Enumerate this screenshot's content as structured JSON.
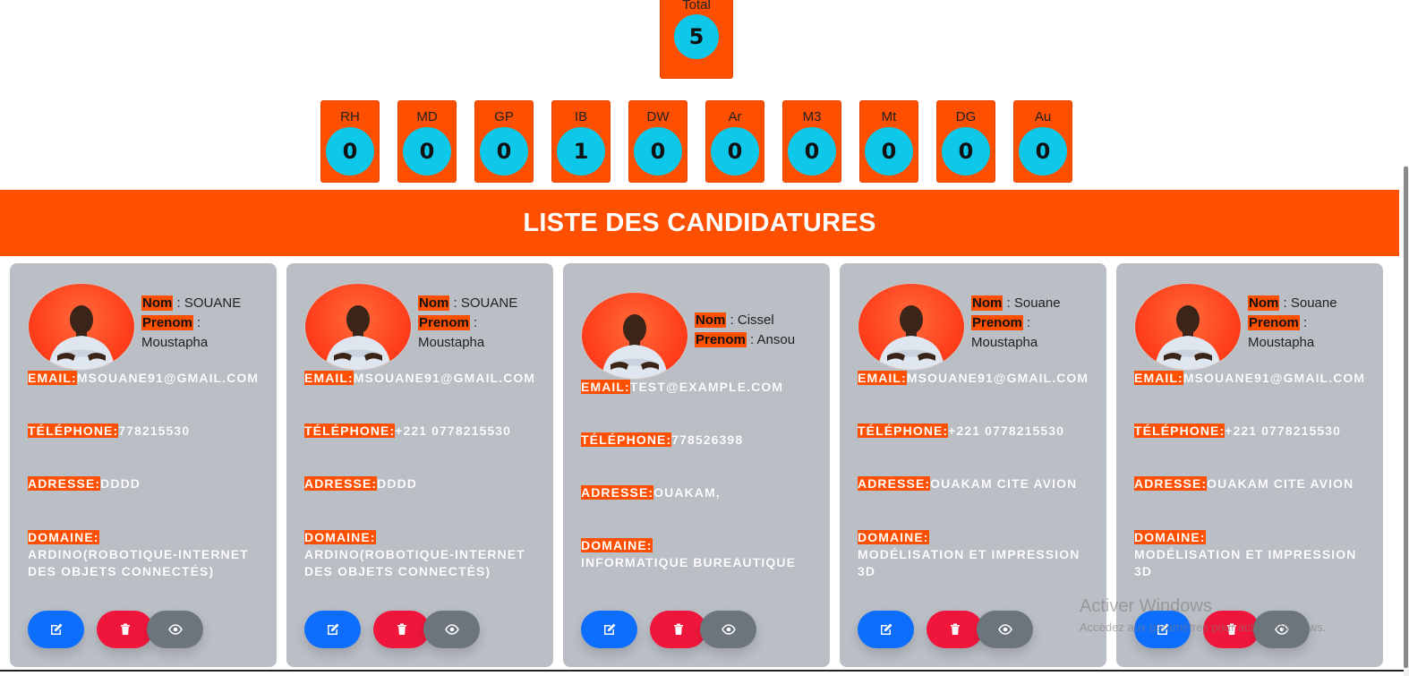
{
  "total": {
    "label": "Total",
    "value": "5"
  },
  "stats": [
    {
      "label": "RH",
      "value": "0"
    },
    {
      "label": "MD",
      "value": "0"
    },
    {
      "label": "GP",
      "value": "0"
    },
    {
      "label": "IB",
      "value": "1"
    },
    {
      "label": "DW",
      "value": "0"
    },
    {
      "label": "Ar",
      "value": "0"
    },
    {
      "label": "M3",
      "value": "0"
    },
    {
      "label": "Mt",
      "value": "0"
    },
    {
      "label": "DG",
      "value": "0"
    },
    {
      "label": "Au",
      "value": "0"
    }
  ],
  "banner_title": "LISTE DES CANDIDATURES",
  "labels": {
    "nom": "Nom",
    "prenom": "Prenom",
    "email": "EMAIL:",
    "telephone": "TÉLÉPHONE:",
    "adresse": "ADRESSE:",
    "domaine": "DOMAINE:"
  },
  "cards": [
    {
      "nom": "SOUANE",
      "prenom": "Moustapha",
      "email": "MSOUANE91@GMAIL.COM",
      "telephone": "778215530",
      "adresse": "DDDD",
      "domaine": "ARDINO(ROBOTIQUE-INTERNET DES OBJETS CONNECTÉS)"
    },
    {
      "nom": "SOUANE",
      "prenom": "Moustapha",
      "email": "MSOUANE91@GMAIL.COM",
      "telephone": "+221 0778215530",
      "adresse": "DDDD",
      "domaine": "ARDINO(ROBOTIQUE-INTERNET DES OBJETS CONNECTÉS)"
    },
    {
      "nom": "Cissel",
      "prenom": "Ansou",
      "email": "TEST@EXAMPLE.COM",
      "telephone": "778526398",
      "adresse": "OUAKAM,",
      "domaine": "INFORMATIQUE BUREAUTIQUE"
    },
    {
      "nom": "Souane",
      "prenom": "Moustapha",
      "email": "MSOUANE91@GMAIL.COM",
      "telephone": "+221 0778215530",
      "adresse": "OUAKAM CITE AVION",
      "domaine": "MODÉLISATION ET IMPRESSION 3D"
    },
    {
      "nom": "Souane",
      "prenom": "Moustapha",
      "email": "MSOUANE91@GMAIL.COM",
      "telephone": "+221 0778215530",
      "adresse": "OUAKAM CITE AVION",
      "domaine": "MODÉLISATION ET IMPRESSION 3D"
    }
  ],
  "icons": {
    "edit": "edit-icon",
    "delete": "trash-icon",
    "view": "eye-icon"
  },
  "colors": {
    "accent": "#ff4f00",
    "bubble": "#0ec8e9",
    "card": "#babec5",
    "edit": "#0d6efd",
    "delete": "#f0163b",
    "view": "#6c757d"
  },
  "watermark": {
    "title": "Activer Windows",
    "subtitle": "Accédez aux paramètres pour activer Windows."
  }
}
